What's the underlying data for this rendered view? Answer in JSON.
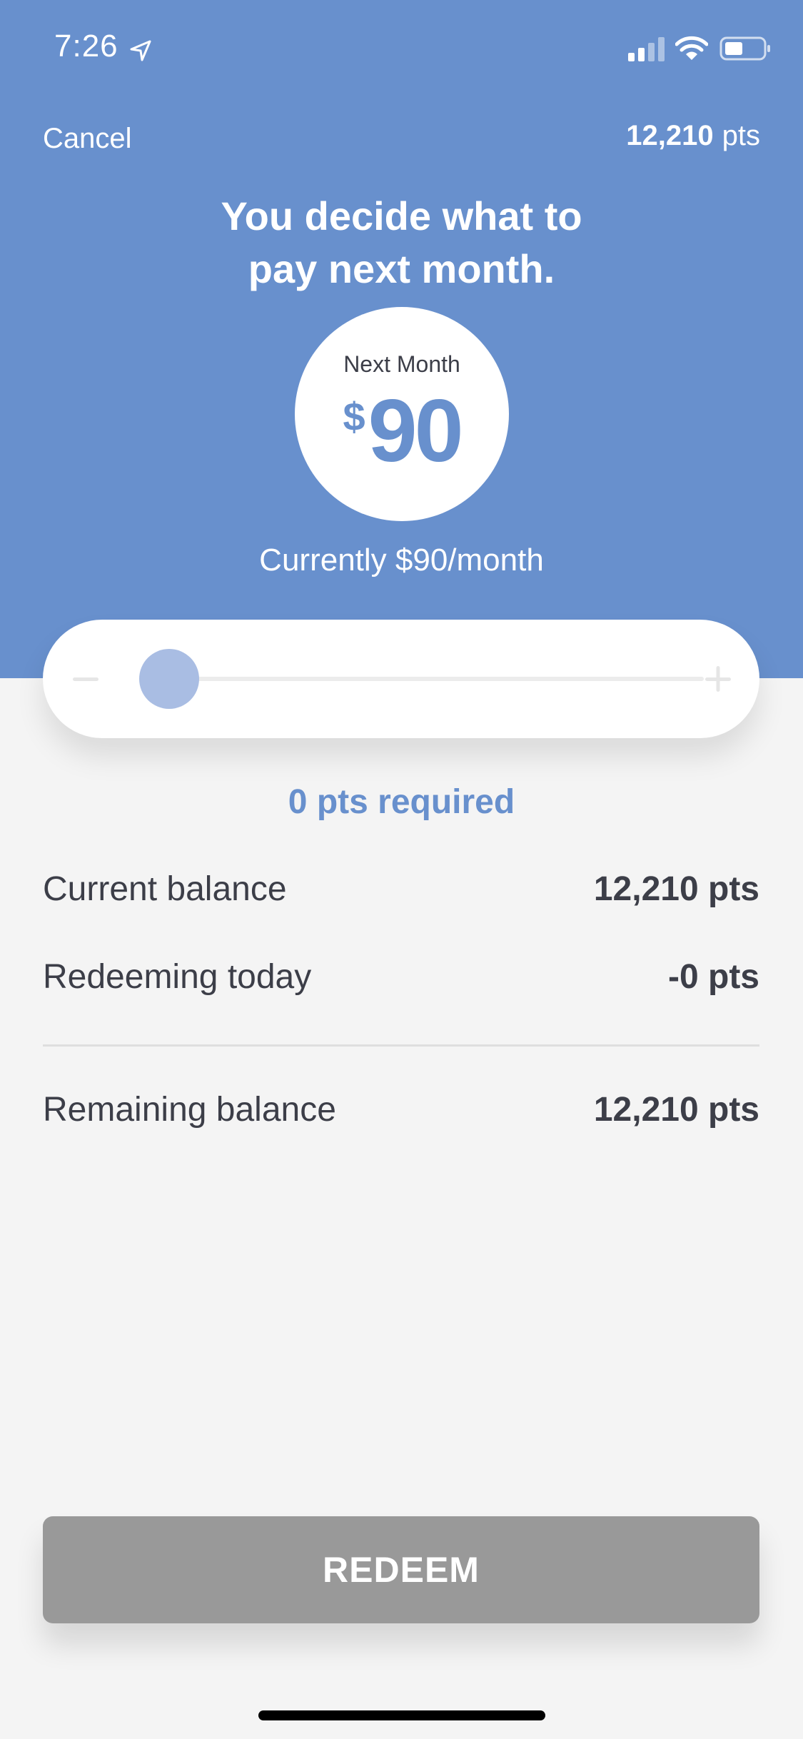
{
  "status_bar": {
    "time": "7:26"
  },
  "nav": {
    "cancel_label": "Cancel",
    "balance_number": "12,210",
    "balance_unit": "pts"
  },
  "headline": {
    "line1": "You decide what to",
    "line2": "pay next month."
  },
  "next_month": {
    "label": "Next Month",
    "currency": "$",
    "amount": "90"
  },
  "current_rate": "Currently $90/month",
  "slider": {
    "min_symbol": "minus",
    "max_symbol": "plus",
    "position": 0
  },
  "pts_required": "0 pts required",
  "summary": {
    "current_balance_label": "Current balance",
    "current_balance_value": "12,210 pts",
    "redeeming_label": "Redeeming today",
    "redeeming_value": "-0 pts",
    "remaining_label": "Remaining balance",
    "remaining_value": "12,210 pts"
  },
  "redeem_label": "REDEEM",
  "colors": {
    "brand_blue": "#6890cd",
    "thumb": "#a9bde3",
    "button_disabled": "#999999",
    "text_dark": "#3c3e48",
    "background": "#f4f4f4"
  }
}
